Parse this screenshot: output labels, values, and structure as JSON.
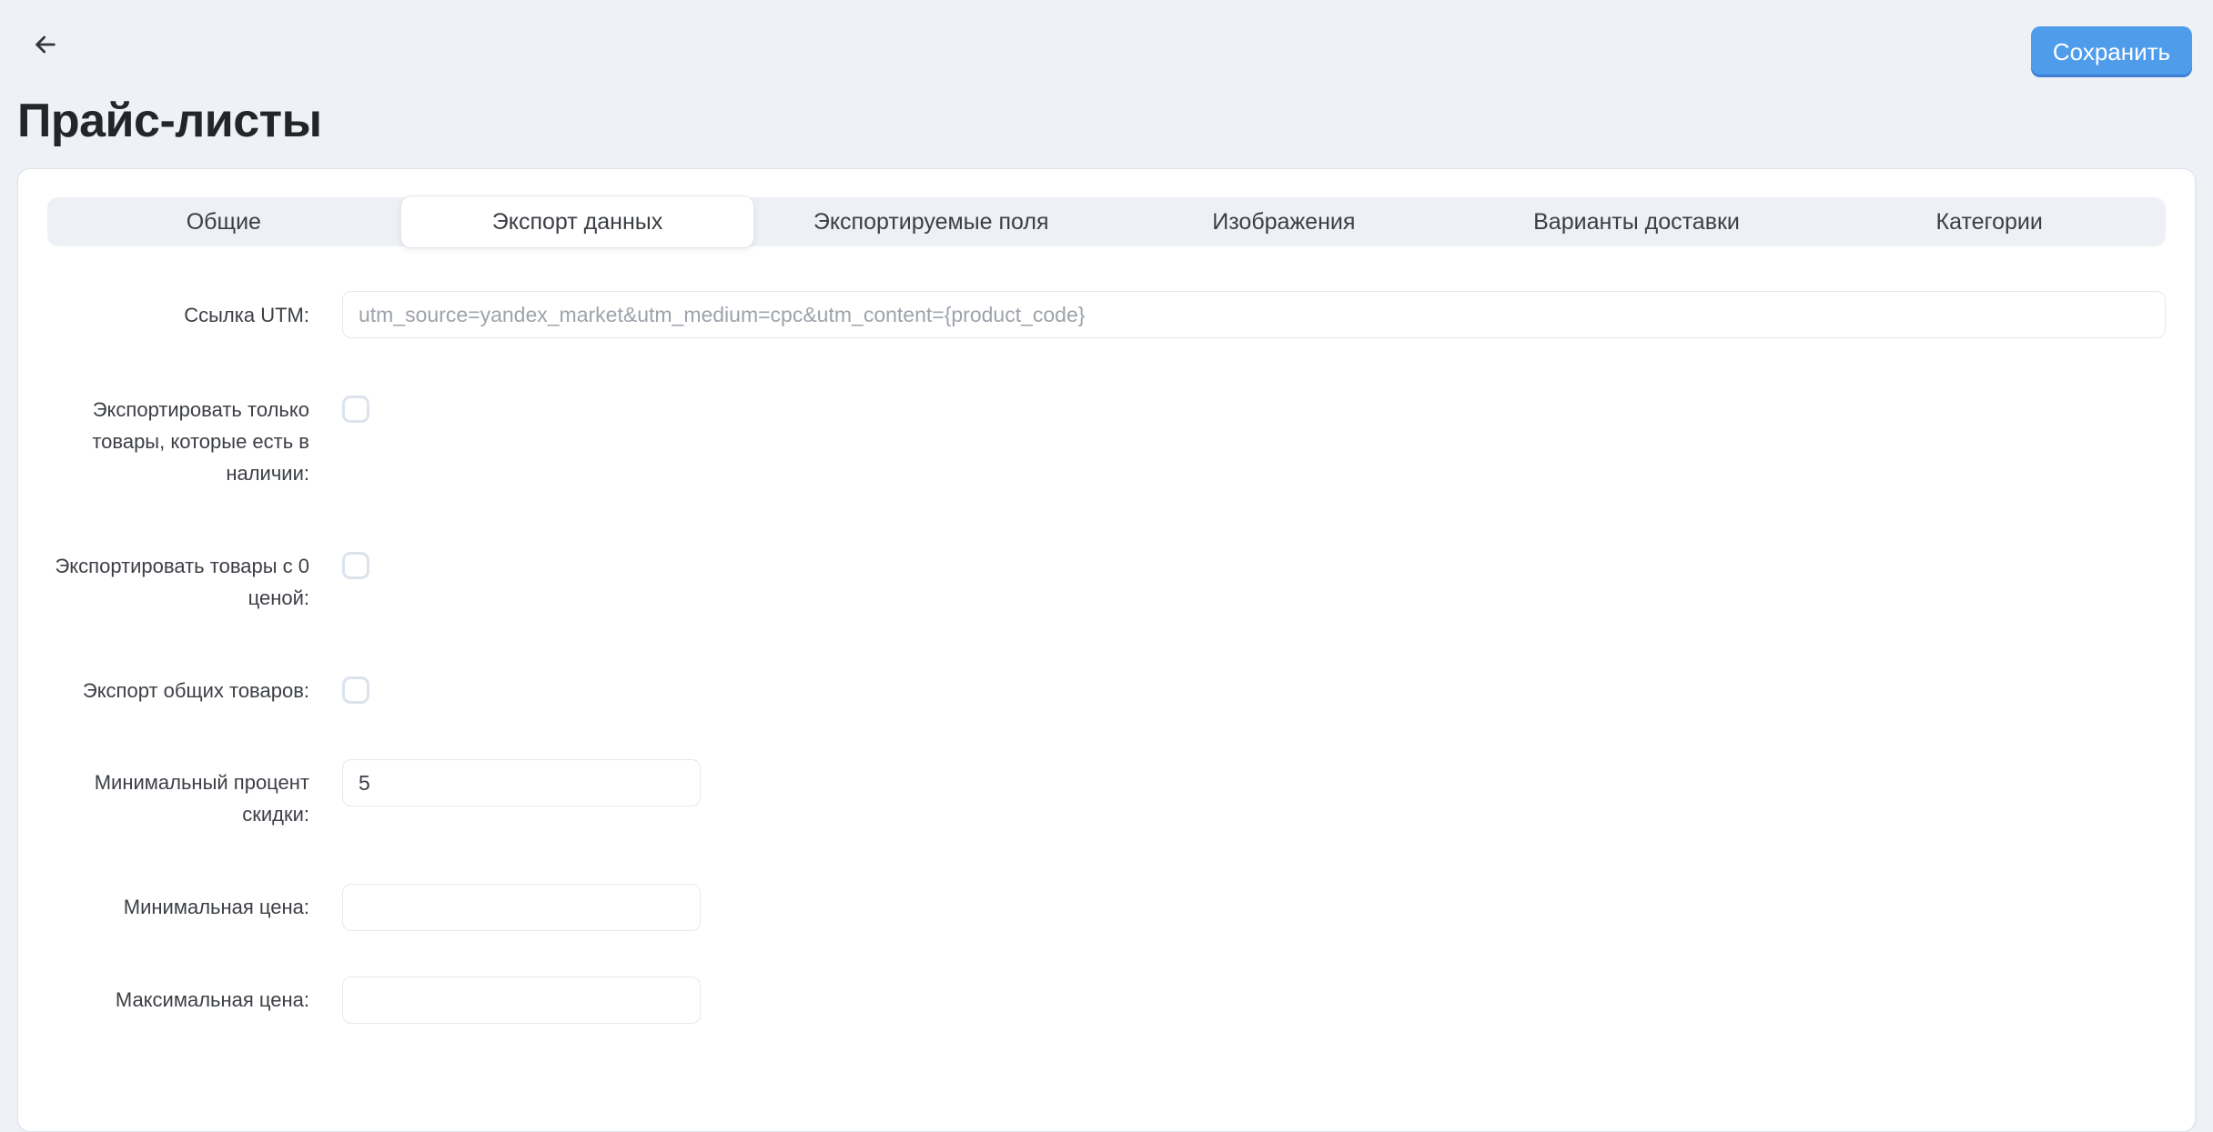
{
  "page": {
    "title": "Прайс-листы"
  },
  "header": {
    "back_icon": "arrow-left-icon",
    "save_button": "Сохранить"
  },
  "tabs": {
    "items": [
      {
        "label": "Общие",
        "active": false
      },
      {
        "label": "Экспорт данных",
        "active": true
      },
      {
        "label": "Экспортируемые поля",
        "active": false
      },
      {
        "label": "Изображения",
        "active": false
      },
      {
        "label": "Варианты доставки",
        "active": false
      },
      {
        "label": "Категории",
        "active": false
      }
    ]
  },
  "form": {
    "utm": {
      "label": "Ссылка UTM:",
      "value": "",
      "placeholder": "utm_source=yandex_market&utm_medium=cpc&utm_content={product_code}"
    },
    "export_in_stock": {
      "label": "Экспортировать только товары, которые есть в наличии:",
      "checked": false
    },
    "export_zero_price": {
      "label": "Экспортировать товары с 0 ценой:",
      "checked": false
    },
    "export_common": {
      "label": "Экспорт общих товаров:",
      "checked": false
    },
    "min_discount": {
      "label": "Минимальный процент скидки:",
      "value": "5"
    },
    "min_price": {
      "label": "Минимальная цена:",
      "value": ""
    },
    "max_price": {
      "label": "Максимальная цена:",
      "value": ""
    }
  },
  "colors": {
    "accent": "#4f9ceb",
    "page_bg": "#eef1f6",
    "card_bg": "#ffffff",
    "tabbar_bg": "#edf0f4",
    "border": "#e4e8ee",
    "text": "#3c3f45",
    "title_text": "#232529",
    "placeholder": "#9da3ab",
    "checkbox_border": "#dce3ed"
  }
}
